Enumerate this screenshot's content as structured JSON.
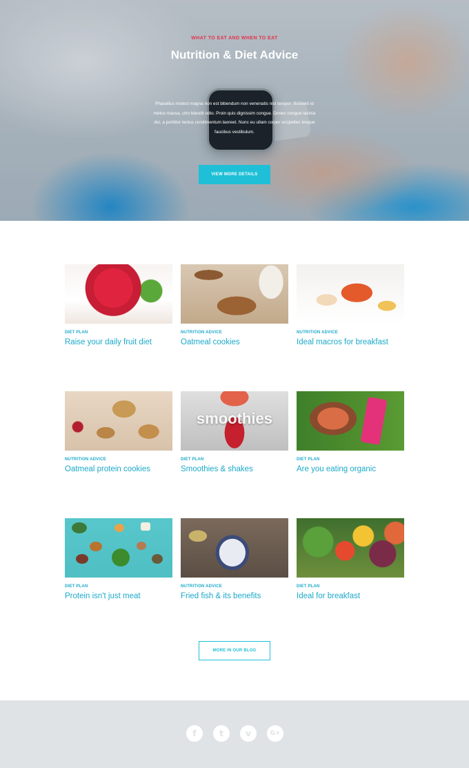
{
  "hero": {
    "kicker": "WHAT TO EAT AND WHEN TO EAT",
    "title": "Nutrition & Diet Advice",
    "text": "Phasellus molest magna non est bibendum non venenatis nisl tempor. Sussent id metus massa, utro blandit odio. Proin quis dignissim congue. Donec congue lacinia dui, a porttitor lectus condimentum laoreet. Nunc eu ullam corper orcipellen tesque faucibus vestibulum.",
    "button_label": "VIEW MORE DETAILS"
  },
  "posts": [
    {
      "category": "DIET PLAN",
      "title": "Raise your daily fruit diet",
      "image": "raspberry-tart"
    },
    {
      "category": "NUTRITION ADVICE",
      "title": "Oatmeal cookies",
      "image": "oatmeal-cookies-milk"
    },
    {
      "category": "NUTRITION ADVICE",
      "title": "Ideal macros for breakfast",
      "image": "lobster-plate"
    },
    {
      "category": "NUTRITION ADVICE",
      "title": "Oatmeal protein cookies",
      "image": "protein-cookies"
    },
    {
      "category": "DIET PLAN",
      "title": "Smoothies & shakes",
      "image": "smoothies",
      "image_text": "smoothies"
    },
    {
      "category": "DIET PLAN",
      "title": "Are you eating organic",
      "image": "organic-fruit-coconut-water"
    },
    {
      "category": "DIET PLAN",
      "title": "Protein isn't just meat",
      "image": "protein-vegetables-board"
    },
    {
      "category": "NUTRITION ADVICE",
      "title": "Fried fish & its benefits",
      "image": "yogurt-parfait"
    },
    {
      "category": "DIET PLAN",
      "title": "Ideal for breakfast",
      "image": "fresh-produce"
    }
  ],
  "blog_button_label": "MORE IN OUR BLOG",
  "footer": {
    "social": [
      {
        "icon": "facebook-icon",
        "glyph": "f"
      },
      {
        "icon": "twitter-icon",
        "glyph": "t"
      },
      {
        "icon": "vimeo-icon",
        "glyph": "v"
      },
      {
        "icon": "google-plus-icon",
        "glyph": "G+"
      }
    ]
  },
  "colors": {
    "accent": "#1fbfd7",
    "link": "#1ba9c9",
    "kicker": "#e2354f",
    "footer_bg": "#dfe3e6"
  }
}
